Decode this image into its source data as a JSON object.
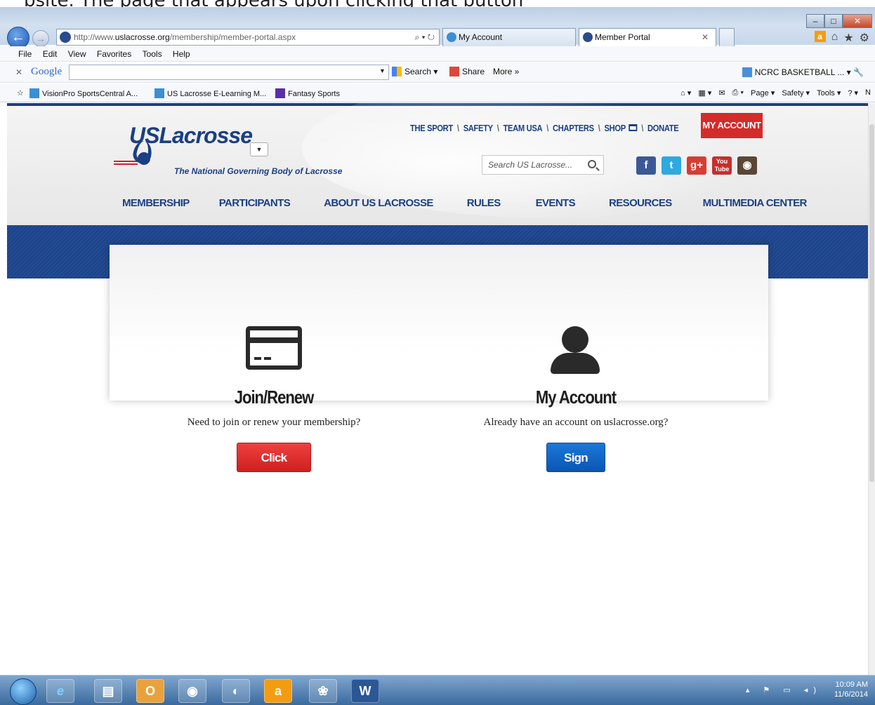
{
  "doc_fragment": "bsite. The page that appears upon clicking that button",
  "browser": {
    "url_prefix": "http://www.",
    "url_domain": "uslacrosse.org",
    "url_path": "/membership/member-portal.aspx",
    "address_tools": "⌕ ▾ ↻",
    "tabs": [
      {
        "label": "My Account"
      },
      {
        "label": "Member Portal"
      }
    ],
    "menu": [
      "File",
      "Edit",
      "View",
      "Favorites",
      "Tools",
      "Help"
    ],
    "google": {
      "logo": "Google",
      "search_btn": "Search ▾",
      "share_btn": "Share",
      "more_btn": "More »",
      "account": "NCRC BASKETBALL ... ▾"
    },
    "favorites": [
      {
        "label": "VisionPro SportsCentral A..."
      },
      {
        "label": "US Lacrosse E-Learning M..."
      },
      {
        "label": "Fantasy Sports"
      }
    ],
    "commands": [
      "Page ▾",
      "Safety ▾",
      "Tools ▾"
    ]
  },
  "site": {
    "logo_word": "USLacrosse",
    "logo_tagline": "The National Governing Body of Lacrosse",
    "util_nav": [
      "THE SPORT",
      "SAFETY",
      "TEAM USA",
      "CHAPTERS",
      "SHOP",
      "DONATE"
    ],
    "my_account_btn": "MY ACCOUNT",
    "search_placeholder": "Search US Lacrosse...",
    "main_nav": [
      "MEMBERSHIP",
      "PARTICIPANTS",
      "ABOUT US LACROSSE",
      "RULES",
      "EVENTS",
      "RESOURCES",
      "MULTIMEDIA CENTER"
    ],
    "social": {
      "facebook": "f",
      "twitter": "t",
      "google_plus": "g+",
      "youtube": "You Tube",
      "instagram": "◉"
    }
  },
  "portal": {
    "join": {
      "title": "Join/Renew",
      "description": "Need to join or renew your membership?",
      "button": "Click Here",
      "icon": "credit-card-icon"
    },
    "account": {
      "title": "My Account",
      "description": "Already have an account on uslacrosse.org?",
      "button": "Sign In",
      "icon": "user-icon"
    }
  },
  "taskbar": {
    "time": "10:09 AM",
    "date": "11/6/2014"
  },
  "colors": {
    "brand_blue": "#1b3f82",
    "red": "#d42b2b",
    "sign_in_blue": "#0a56b4"
  }
}
